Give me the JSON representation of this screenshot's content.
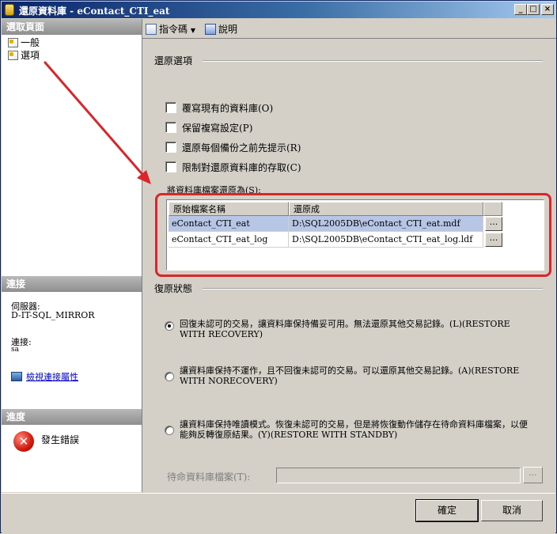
{
  "window": {
    "title": "還原資料庫 - eContact_CTI_eat",
    "min_glyph": "_",
    "max_glyph": "□",
    "close_glyph": "×"
  },
  "left_panel": {
    "select_page_header": "選取頁面",
    "pages": [
      {
        "label": "一般",
        "icon": "page-icon"
      },
      {
        "label": "選項",
        "icon": "page-icon"
      }
    ],
    "connection_header": "連接",
    "server_label": "伺服器:",
    "server_value": "D-IT-SQL_MIRROR",
    "connection_label": "連接:",
    "connection_value": "sa",
    "view_connection_link": "檢視連接屬性",
    "progress_header": "進度",
    "progress_status": "發生錯誤"
  },
  "toolbar": {
    "script_label": "指令碼",
    "help_label": "說明"
  },
  "restore_options": {
    "group_label": "還原選項",
    "checkboxes": [
      {
        "label": "覆寫現有的資料庫(O)",
        "checked": false
      },
      {
        "label": "保留複寫設定(P)",
        "checked": false
      },
      {
        "label": "還原每個備份之前先提示(R)",
        "checked": false
      },
      {
        "label": "限制對還原資料庫的存取(C)",
        "checked": false
      }
    ],
    "files_label": "將資料庫檔案還原為(S):",
    "grid": {
      "columns": [
        "原始檔案名稱",
        "還原成"
      ],
      "rows": [
        {
          "original": "eContact_CTI_eat",
          "restore_as": "D:\\SQL2005DB\\eContact_CTI_eat.mdf",
          "selected": true
        },
        {
          "original": "eContact_CTI_eat_log",
          "restore_as": "D:\\SQL2005DB\\eContact_CTI_eat_log.ldf",
          "selected": false
        }
      ],
      "ellipsis": "..."
    }
  },
  "recovery_state": {
    "group_label": "復原狀態",
    "options": [
      {
        "text": "回復未認可的交易，讓資料庫保持備妥可用。無法還原其他交易記錄。(L)(RESTORE WITH RECOVERY)",
        "selected": true
      },
      {
        "text": "讓資料庫保持不運作，且不回復未認可的交易。可以還原其他交易記錄。(A)(RESTORE WITH NORECOVERY)",
        "selected": false
      },
      {
        "text": "讓資料庫保持唯讀模式。恢復未認可的交易，但是將恢復動作儲存在待命資料庫檔案，以便能夠反轉復原結果。(Y)(RESTORE WITH STANDBY)",
        "selected": false
      }
    ],
    "standby_label": "待命資料庫檔案(T):",
    "standby_value": "",
    "standby_button": "..."
  },
  "buttons": {
    "ok": "確定",
    "cancel": "取消"
  },
  "colors": {
    "annotation_red": "#d9262a",
    "selected_row": "#b8c6e6",
    "title_bar": "#0a246a"
  }
}
